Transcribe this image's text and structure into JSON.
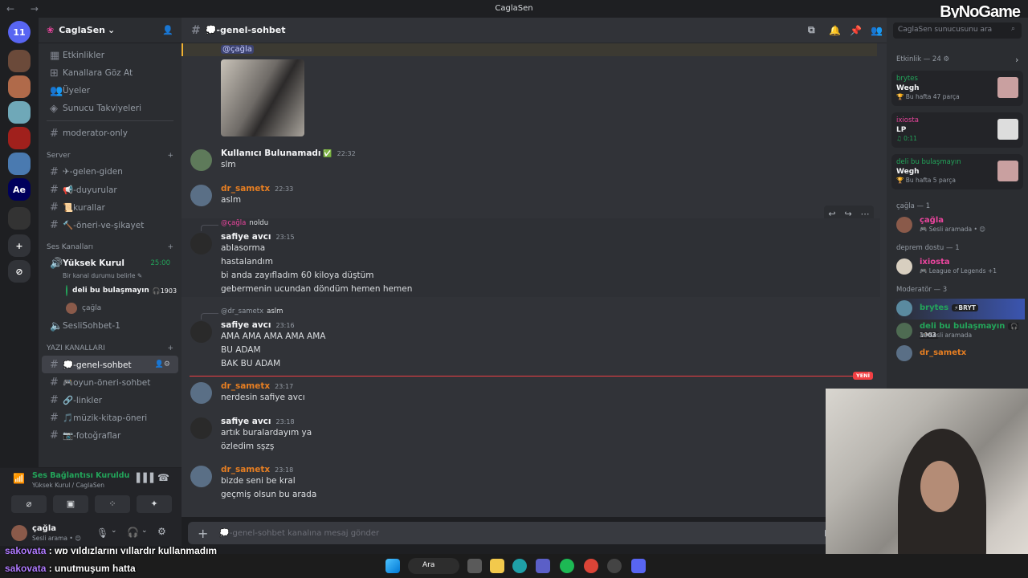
{
  "window": {
    "title": "CaglaSen",
    "nav": "← →",
    "watermark": "ByNoGame"
  },
  "servers": [
    {
      "label": "11",
      "color": "#5865f2"
    },
    {
      "label": "",
      "color": "#6b4a3a"
    },
    {
      "label": "",
      "color": "#b06a4a"
    },
    {
      "label": "",
      "color": "#6fa8b8"
    },
    {
      "label": "",
      "color": "#a0201c"
    },
    {
      "label": "",
      "color": "#4a7ab0"
    },
    {
      "label": "Ae",
      "color": "#00005b"
    },
    {
      "label": "",
      "color": "#333"
    },
    {
      "label": "+",
      "color": "#313338"
    },
    {
      "label": "⊘",
      "color": "#313338"
    }
  ],
  "server": {
    "name": "CaglaSen"
  },
  "menu": [
    "Etkinlikler",
    "Kanallara Göz At",
    "Üyeler",
    "Sunucu Takviyeleri"
  ],
  "channels_top": [
    "moderator-only"
  ],
  "cat_server": "Server",
  "server_channels": [
    "✈-gelen-giden",
    "📢-duyurular",
    "📜kurallar",
    "🔨-öneri-ve-şikayet"
  ],
  "cat_voice": "Ses Kanalları",
  "voice": {
    "name": "Yüksek Kurul",
    "timer": "25:00",
    "status": "Bir kanal durumu belirle ✎",
    "users": [
      {
        "name": "deli bu bulaşmayın",
        "badge": "🎧1903"
      },
      {
        "name": "çağla",
        "badge": ""
      }
    ],
    "other": "SesliSohbet-1"
  },
  "cat_text": "YAZI KANALLARI",
  "text_channels": [
    "💭-genel-sohbet",
    "🎮oyun-öneri-sohbet",
    "🔗-linkler",
    "🎵müzik-kitap-öneri",
    "📷-fotoğraflar"
  ],
  "voice_panel": {
    "status": "Ses Bağlantısı Kuruldu",
    "path": "Yüksek Kurul / CaglaSen"
  },
  "user_panel": {
    "name": "çağla",
    "status": "Sesli arama • 😊"
  },
  "chat": {
    "channel": "💭-genel-sohbet",
    "placeholder": "💭-genel-sohbet kanalına mesaj gönder",
    "mention": "@çağla",
    "new_label": "YENİ"
  },
  "messages": [
    {
      "user": "Kullanıcı Bulunamadı",
      "color": "#f2f3f5",
      "time": "22:32",
      "lines": [
        "slm"
      ],
      "reply": null
    },
    {
      "user": "dr_sametx",
      "color": "#e67e22",
      "time": "22:33",
      "lines": [
        "aslm"
      ],
      "reply": null
    },
    {
      "user": "safiye avcı",
      "color": "#f2f3f5",
      "time": "23:15",
      "lines": [
        "ablasorma",
        "hastalandım",
        "bi anda zayıfladım 60 kiloya düştüm",
        "gebermenin ucundan döndüm hemen hemen"
      ],
      "reply": {
        "who": "@çağla",
        "text": "noldu"
      }
    },
    {
      "user": "safiye avcı",
      "color": "#f2f3f5",
      "time": "23:16",
      "lines": [
        "AMA AMA AMA AMA AMA",
        "BU ADAM",
        "BAK BU ADAM"
      ],
      "reply": {
        "who": "@dr_sametx",
        "text": "aslm"
      }
    },
    {
      "user": "dr_sametx",
      "color": "#e67e22",
      "time": "23:17",
      "lines": [
        "nerdesin safiye avcı"
      ],
      "reply": null
    },
    {
      "user": "safiye avcı",
      "color": "#f2f3f5",
      "time": "23:18",
      "lines": [
        "artık buralardayım ya",
        "özledim sşzş"
      ],
      "reply": null
    },
    {
      "user": "dr_sametx",
      "color": "#e67e22",
      "time": "23:18",
      "lines": [
        "bizde seni be kral",
        "geçmiş olsun bu arada"
      ],
      "reply": null
    }
  ],
  "members": {
    "search": "CaglaSen sunucusunu ara",
    "activity_header": "Etkinlik — 24 ⚙",
    "activities": [
      {
        "user": "brytes",
        "ucolor": "#23a55a",
        "title": "Wegh",
        "sub": "🏆 Bu hafta 47 parça"
      },
      {
        "user": "ixiosta",
        "ucolor": "#eb459e",
        "title": "LP",
        "sub": "♫ 0:11"
      },
      {
        "user": "deli bu bulaşmayın",
        "ucolor": "#23a55a",
        "title": "Wegh",
        "sub": "🏆 Bu hafta 5 parça"
      }
    ],
    "groups": [
      {
        "header": "çağla — 1",
        "members": [
          {
            "name": "çağla",
            "color": "#eb459e",
            "status": "🎮 Sesli aramada • 😊"
          }
        ]
      },
      {
        "header": "deprem dostu — 1",
        "members": [
          {
            "name": "ixiosta",
            "color": "#eb459e",
            "status": "🎮 League of Legends +1"
          }
        ]
      },
      {
        "header": "Moderatör — 3",
        "members": [
          {
            "name": "brytes",
            "color": "#23a55a",
            "status": "",
            "tag": "⚡BRYT"
          },
          {
            "name": "deli bu bulaşmayın",
            "color": "#23a55a",
            "status": "🎮 Sesli aramada",
            "tag": "🎧1903"
          },
          {
            "name": "dr_sametx",
            "color": "#e67e22",
            "status": "",
            "tag": ""
          }
        ]
      }
    ]
  },
  "overlay": [
    {
      "name": "sakovata",
      "text": " : wp yıldızlarını yıllardır kullanmadım"
    },
    {
      "name": "sakovata",
      "text": " : unutmuşum hatta"
    }
  ],
  "taskbar": {
    "search": "Ara"
  }
}
